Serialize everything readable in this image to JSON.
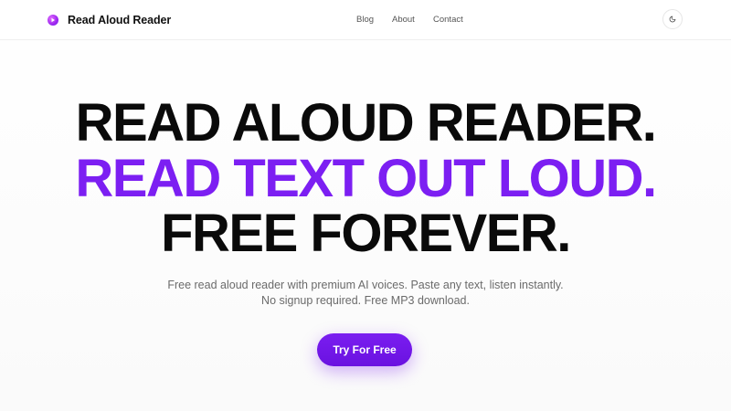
{
  "header": {
    "brand_name": "Read Aloud Reader",
    "logo_icon": "play-circle-icon",
    "nav": {
      "blog": "Blog",
      "about": "About",
      "contact": "Contact"
    },
    "theme_toggle_icon": "moon-icon"
  },
  "hero": {
    "line1": "READ ALOUD READER.",
    "line2": "READ TEXT OUT LOUD.",
    "line3": "FREE FOREVER.",
    "subtitle": "Free read aloud reader with premium AI voices. Paste any text, listen instantly. No signup required. Free MP3 download.",
    "cta_label": "Try For Free"
  },
  "colors": {
    "accent": "#7c1ff2",
    "heading": "#0a0a0a",
    "body_text": "#6b6b6b",
    "nav_text": "#555555"
  }
}
